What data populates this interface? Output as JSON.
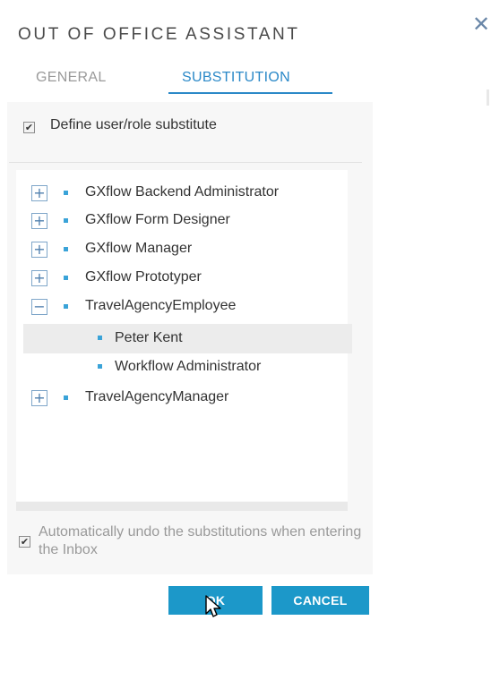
{
  "dialog": {
    "title": "OUT OF OFFICE ASSISTANT",
    "close_icon": "close-icon"
  },
  "tabs": [
    {
      "label": "GENERAL",
      "active": false
    },
    {
      "label": "SUBSTITUTION",
      "active": true
    }
  ],
  "define_substitute": {
    "label": "Define user/role substitute",
    "checked": true
  },
  "tree": {
    "nodes": [
      {
        "label": "GXflow Backend Administrator",
        "toggle": "+"
      },
      {
        "label": "GXflow Form Designer",
        "toggle": "+"
      },
      {
        "label": "GXflow Manager",
        "toggle": "+"
      },
      {
        "label": "GXflow Prototyper",
        "toggle": "+"
      },
      {
        "label": "TravelAgencyEmployee",
        "toggle": "−"
      },
      {
        "label": "Peter Kent",
        "selected": true
      },
      {
        "label": "Workflow Administrator"
      },
      {
        "label": "TravelAgencyManager",
        "toggle": "+"
      }
    ]
  },
  "auto_undo": {
    "label": "Automatically undo the substitutions when entering the Inbox",
    "checked": true
  },
  "buttons": {
    "ok": "OK",
    "cancel": "CANCEL"
  },
  "colors": {
    "accent": "#2b89c8",
    "button": "#1c98c9",
    "bullet": "#3aa3d8"
  }
}
